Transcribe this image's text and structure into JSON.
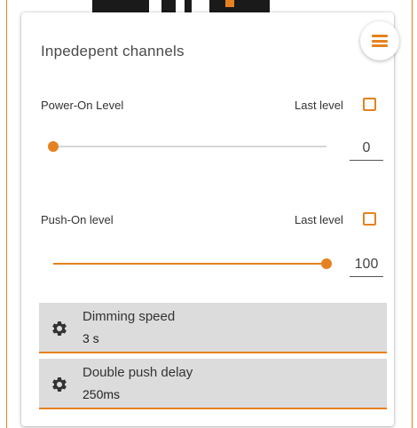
{
  "colors": {
    "accent": "#e5821f",
    "box_background": "#dcdcdc",
    "track": "#d6d6d6"
  },
  "card": {
    "title": "Inpedepent channels"
  },
  "menu": {
    "icon": "hamburger-menu-icon"
  },
  "power_on": {
    "label": "Power-On Level",
    "last_level_label": "Last level",
    "last_level_checked": false,
    "value": "0",
    "level_fraction": 0.0
  },
  "push_on": {
    "label": "Push-On level",
    "last_level_label": "Last level",
    "last_level_checked": false,
    "value": "100",
    "level_fraction": 1.0
  },
  "settings": [
    {
      "name": "Dimming speed",
      "value": "3 s",
      "icon": "gear-icon"
    },
    {
      "name": "Double push delay",
      "value": "250ms",
      "icon": "gear-icon"
    }
  ]
}
